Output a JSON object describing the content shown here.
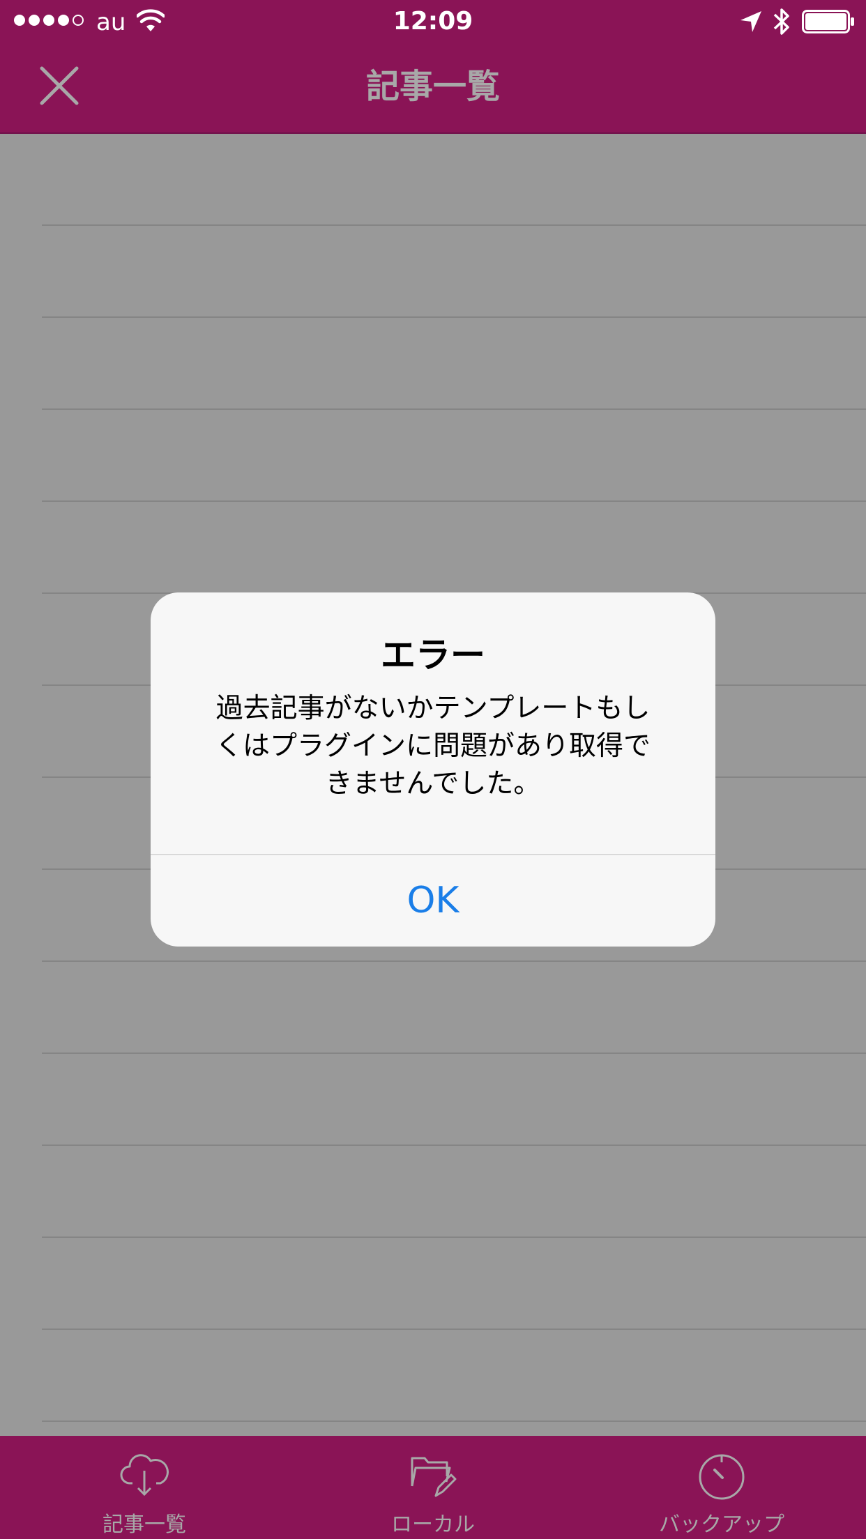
{
  "status_bar": {
    "carrier": "au",
    "time": "12:09",
    "signal_bars_filled": 4,
    "signal_bars_total": 5
  },
  "nav": {
    "title": "記事一覧",
    "close_icon": "close-icon"
  },
  "list": {
    "row_count": 14
  },
  "alert": {
    "title": "エラー",
    "message_lines": [
      "過去記事がないかテンプレートもし",
      "くはプラグインに問題があり取得で",
      "きませんでした。"
    ],
    "ok_label": "OK"
  },
  "tabs": [
    {
      "label": "記事一覧",
      "icon": "cloud-download-icon"
    },
    {
      "label": "ローカル",
      "icon": "folder-edit-icon"
    },
    {
      "label": "バックアップ",
      "icon": "timer-icon"
    }
  ],
  "colors": {
    "brand": "#8a1456",
    "overlay_gray": "#999999",
    "alert_button": "#1a7ee8",
    "muted_text": "#a8a8a8"
  }
}
